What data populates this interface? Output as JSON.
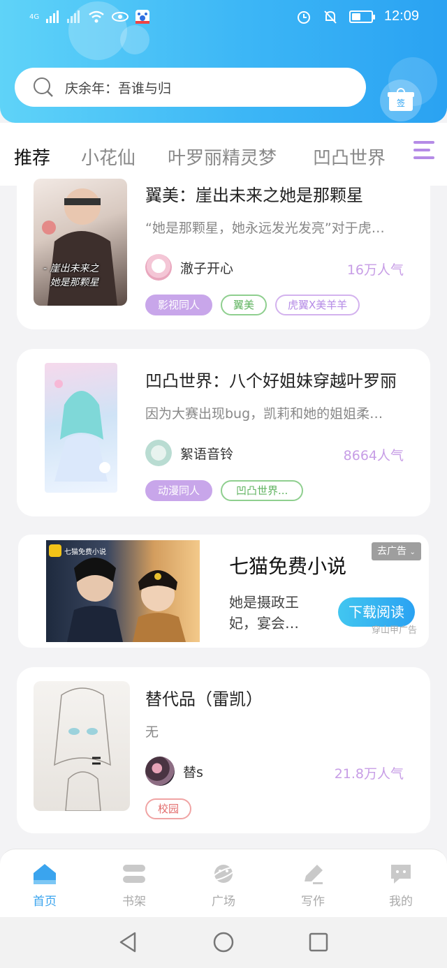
{
  "status_bar": {
    "network": "4G",
    "time": "12:09"
  },
  "search": {
    "query": "庆余年：吾谁与归"
  },
  "sign_in": {
    "label": "签"
  },
  "tabs": [
    {
      "label": "推荐",
      "active": true
    },
    {
      "label": "小花仙",
      "active": false
    },
    {
      "label": "叶罗丽精灵梦",
      "active": false
    },
    {
      "label": "凹凸世界",
      "active": false
    }
  ],
  "books": [
    {
      "title": "翼美：崖出未来之她是那颗星",
      "desc": "“她是那颗星，她永远发光发亮”对于虎…",
      "author": "澈子开心",
      "popularity": "16万人气",
      "cover_caption": "- 崖出未来之\n她是那颗星",
      "tags": [
        {
          "label": "影视同人",
          "style": "filled"
        },
        {
          "label": "翼美",
          "style": "green"
        },
        {
          "label": "虎翼X美羊羊",
          "style": "purple"
        }
      ]
    },
    {
      "title": "凹凸世界：八个好姐妹穿越叶罗丽",
      "desc": "因为大赛出现bug，凯莉和她的姐姐柔…",
      "author": "絮语音铃",
      "popularity": "8664人气",
      "tags": [
        {
          "label": "动漫同人",
          "style": "filled"
        },
        {
          "label": "凹凸世界...",
          "style": "green"
        }
      ]
    },
    {
      "title": "替代品（雷凯）",
      "desc": "无",
      "author": "替s",
      "popularity": "21.8万人气",
      "tags": [
        {
          "label": "校园",
          "style": "red"
        }
      ]
    }
  ],
  "ad": {
    "brand_badge": "七猫免费小说",
    "title": "七猫免费小说",
    "desc": "她是摄政王妃，宴会…",
    "button": "下载阅读",
    "close": "去广告",
    "sub": "穿山甲广告"
  },
  "bottom_nav": [
    {
      "label": "首页",
      "icon": "home-icon",
      "active": true
    },
    {
      "label": "书架",
      "icon": "bookshelf-icon",
      "active": false
    },
    {
      "label": "广场",
      "icon": "planet-icon",
      "active": false
    },
    {
      "label": "写作",
      "icon": "pen-icon",
      "active": false
    },
    {
      "label": "我的",
      "icon": "chat-face-icon",
      "active": false
    }
  ],
  "colors": {
    "header_start": "#5fd3f8",
    "header_end": "#2aa2f2",
    "accent_purple": "#b58be6",
    "popularity": "#c79de6",
    "nav_active": "#3aa4ee"
  }
}
